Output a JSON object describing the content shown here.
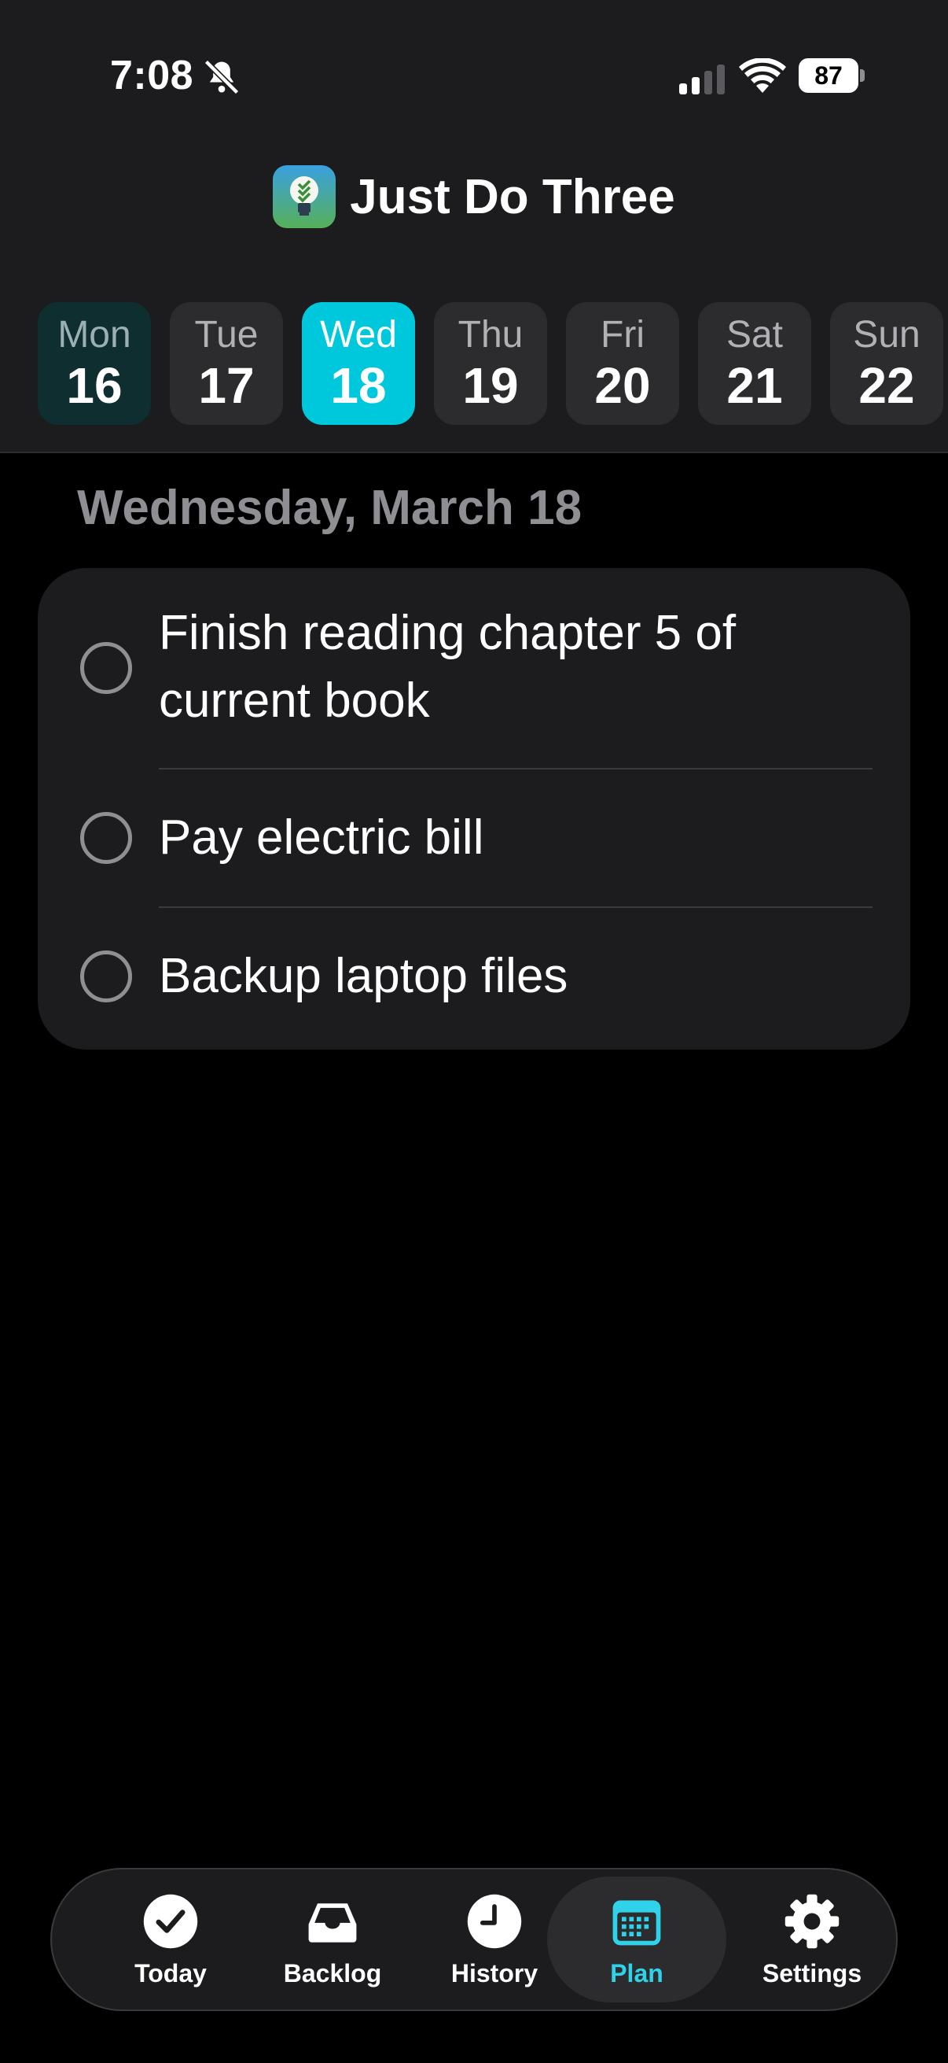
{
  "status_bar": {
    "time": "7:08",
    "battery": "87"
  },
  "app": {
    "title": "Just Do Three"
  },
  "week": {
    "days": [
      {
        "name": "Mon",
        "num": "16"
      },
      {
        "name": "Tue",
        "num": "17"
      },
      {
        "name": "Wed",
        "num": "18"
      },
      {
        "name": "Thu",
        "num": "19"
      },
      {
        "name": "Fri",
        "num": "20"
      },
      {
        "name": "Sat",
        "num": "21"
      },
      {
        "name": "Sun",
        "num": "22"
      }
    ],
    "selected_index": 2
  },
  "main": {
    "date_heading": "Wednesday, March 18",
    "tasks": [
      {
        "text": "Finish reading chapter 5 of current book"
      },
      {
        "text": "Pay electric bill"
      },
      {
        "text": "Backup laptop files"
      }
    ]
  },
  "tab_bar": {
    "items": [
      {
        "label": "Today",
        "icon": "checkmark-circle-icon"
      },
      {
        "label": "Backlog",
        "icon": "tray-icon"
      },
      {
        "label": "History",
        "icon": "clock-icon"
      },
      {
        "label": "Plan",
        "icon": "calendar-icon"
      },
      {
        "label": "Settings",
        "icon": "gear-icon"
      }
    ],
    "active_index": 3
  },
  "colors": {
    "accent": "#00c8dc",
    "background": "#000000",
    "surface": "#1c1c1e"
  }
}
